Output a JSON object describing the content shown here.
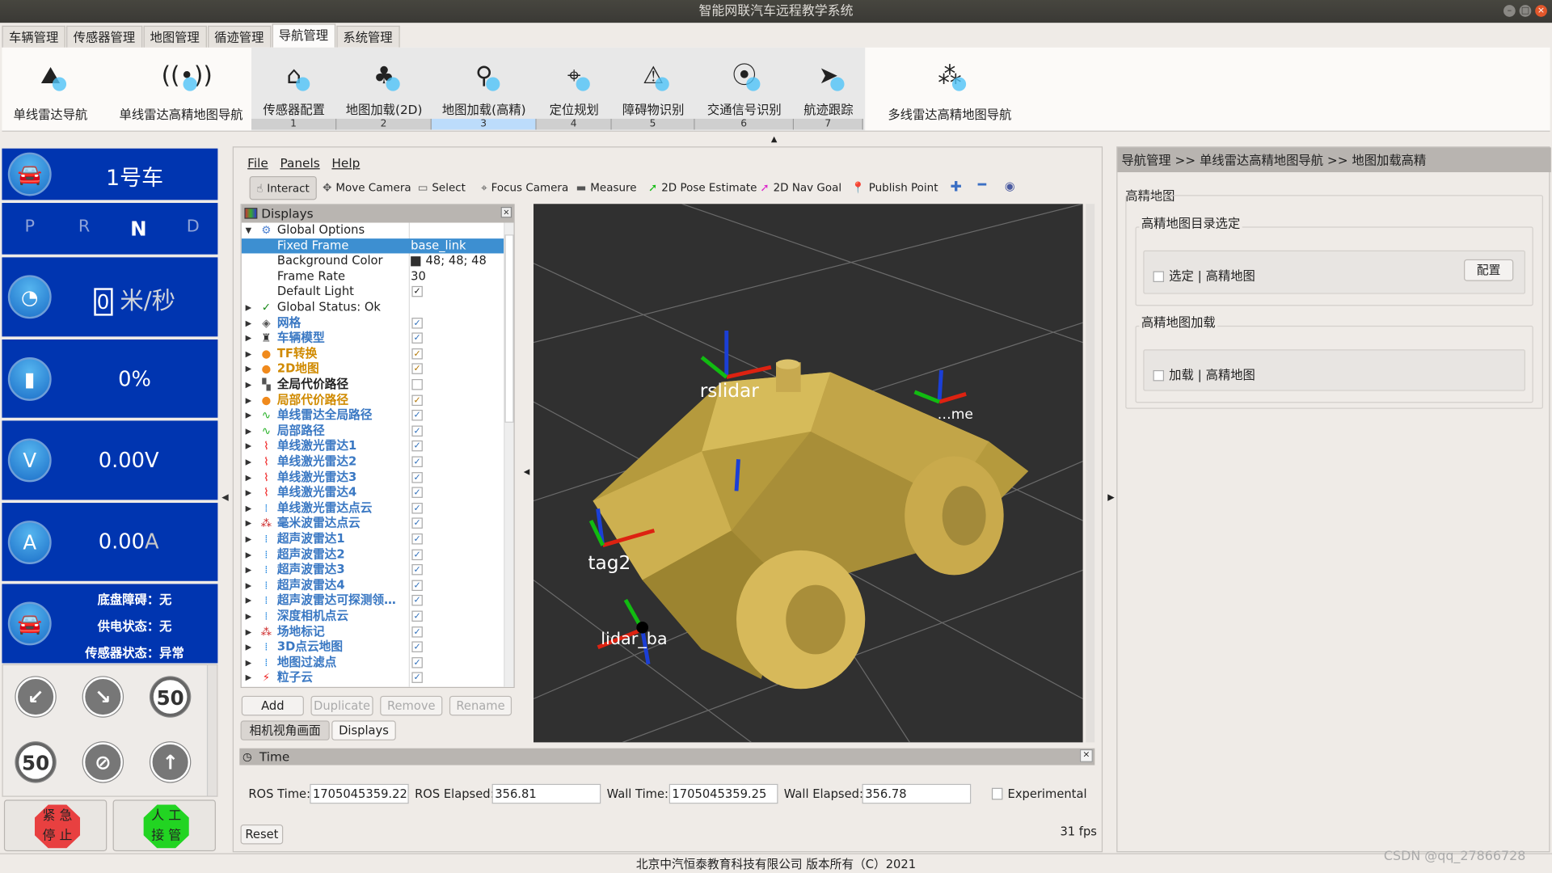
{
  "window": {
    "title": "智能网联汽车远程教学系统"
  },
  "tabs": [
    {
      "label": "车辆管理"
    },
    {
      "label": "传感器管理"
    },
    {
      "label": "地图管理"
    },
    {
      "label": "循迹管理"
    },
    {
      "label": "导航管理",
      "active": true
    },
    {
      "label": "系统管理"
    }
  ],
  "ribbon": {
    "left": [
      {
        "label": "单线雷达导航",
        "icon": "map-arrow-icon"
      },
      {
        "label": "单线雷达高精地图导航",
        "icon": "radio-signal-icon"
      }
    ],
    "steps": [
      {
        "label": "传感器配置",
        "num": "1",
        "icon": "sensor-icon"
      },
      {
        "label": "地图加载(2D)",
        "num": "2",
        "icon": "tree-map-icon"
      },
      {
        "label": "地图加载(高精)",
        "num": "3",
        "icon": "map-pin-icon",
        "selected": true
      },
      {
        "label": "定位规划",
        "num": "4",
        "icon": "location-icon"
      },
      {
        "label": "障碍物识别",
        "num": "5",
        "icon": "obstacle-icon"
      },
      {
        "label": "交通信号识别",
        "num": "6",
        "icon": "traffic-light-icon"
      },
      {
        "label": "航迹跟踪",
        "num": "7",
        "icon": "navigation-icon"
      }
    ],
    "right": {
      "label": "多线雷达高精地图导航",
      "icon": "nodes-icon"
    }
  },
  "left_panel": {
    "vehicle": "1号车",
    "gears": [
      "P",
      "R",
      "N",
      "D"
    ],
    "active_gear": "N",
    "speed_value": "0",
    "speed_unit": "米/秒",
    "battery": "0%",
    "voltage": "0.00V",
    "current_value": "0.00",
    "current_unit": "A",
    "status": [
      {
        "label": "底盘障碍：",
        "value": "无"
      },
      {
        "label": "供电状态：",
        "value": "无"
      },
      {
        "label": "传感器状态：",
        "value": "异常"
      }
    ],
    "signs": [
      "↙",
      "↘",
      "50",
      "50",
      "⊘",
      "↑"
    ],
    "emergency": {
      "line1": "紧 急",
      "line2": "停 止",
      "color": "#e84040"
    },
    "takeover": {
      "line1": "人 工",
      "line2": "接 管",
      "color": "#22d422"
    }
  },
  "rviz": {
    "menu": [
      "File",
      "Panels",
      "Help"
    ],
    "tools": [
      {
        "label": "Interact",
        "icon": "hand-icon"
      },
      {
        "label": "Move Camera",
        "icon": "move-icon"
      },
      {
        "label": "Select",
        "icon": "select-icon"
      },
      {
        "label": "Focus Camera",
        "icon": "focus-icon"
      },
      {
        "label": "Measure",
        "icon": "ruler-icon"
      },
      {
        "label": "2D Pose Estimate",
        "icon": "green-arrow-icon"
      },
      {
        "label": "2D Nav Goal",
        "icon": "pink-arrow-icon"
      },
      {
        "label": "Publish Point",
        "icon": "pin-icon"
      }
    ],
    "displays_title": "Displays",
    "global_options": "Global Options",
    "props": [
      {
        "label": "Fixed Frame",
        "value": "base_link"
      },
      {
        "label": "Background Color",
        "value": "48; 48; 48"
      },
      {
        "label": "Frame Rate",
        "value": "30"
      },
      {
        "label": "Default Light",
        "value": "✓"
      }
    ],
    "global_status": "Global Status: Ok",
    "items": [
      {
        "label": "网格",
        "icon": "grid-icon",
        "color": "#3a78c3",
        "checked": true
      },
      {
        "label": "车辆模型",
        "icon": "robot-icon",
        "color": "#3a78c3",
        "checked": true
      },
      {
        "label": "TF转换",
        "icon": "warning-icon",
        "color": "#d08a00",
        "checked": true
      },
      {
        "label": "2D地图",
        "icon": "warning-icon",
        "color": "#d08a00",
        "checked": true
      },
      {
        "label": "全局代价路径",
        "icon": "map-icon",
        "color": "#222222",
        "checked": false
      },
      {
        "label": "局部代价路径",
        "icon": "warning-icon",
        "color": "#d08a00",
        "checked": true
      },
      {
        "label": "单线雷达全局路径",
        "icon": "path-icon",
        "color": "#3a78c3",
        "checked": true
      },
      {
        "label": "局部路径",
        "icon": "path-icon",
        "color": "#3a78c3",
        "checked": true
      },
      {
        "label": "单线激光雷达1",
        "icon": "laser-icon",
        "color": "#3a78c3",
        "checked": true
      },
      {
        "label": "单线激光雷达2",
        "icon": "laser-icon",
        "color": "#3a78c3",
        "checked": true
      },
      {
        "label": "单线激光雷达3",
        "icon": "laser-icon",
        "color": "#3a78c3",
        "checked": true
      },
      {
        "label": "单线激光雷达4",
        "icon": "laser-icon",
        "color": "#3a78c3",
        "checked": true
      },
      {
        "label": "单线激光雷达点云",
        "icon": "pointcloud-icon",
        "color": "#3a78c3",
        "checked": true
      },
      {
        "label": "毫米波雷达点云",
        "icon": "marker-icon",
        "color": "#3a78c3",
        "checked": true
      },
      {
        "label": "超声波雷达1",
        "icon": "pointcloud-icon",
        "color": "#3a78c3",
        "checked": true
      },
      {
        "label": "超声波雷达2",
        "icon": "pointcloud-icon",
        "color": "#3a78c3",
        "checked": true
      },
      {
        "label": "超声波雷达3",
        "icon": "pointcloud-icon",
        "color": "#3a78c3",
        "checked": true
      },
      {
        "label": "超声波雷达4",
        "icon": "pointcloud-icon",
        "color": "#3a78c3",
        "checked": true
      },
      {
        "label": "超声波雷达可探测领…",
        "icon": "pointcloud-icon",
        "color": "#3a78c3",
        "checked": true
      },
      {
        "label": "深度相机点云",
        "icon": "pointcloud-icon",
        "color": "#3a78c3",
        "checked": true
      },
      {
        "label": "场地标记",
        "icon": "marker-icon",
        "color": "#3a78c3",
        "checked": true
      },
      {
        "label": "3D点云地图",
        "icon": "pointcloud-icon",
        "color": "#3a78c3",
        "checked": true
      },
      {
        "label": "地图过滤点",
        "icon": "pointcloud-icon",
        "color": "#3a78c3",
        "checked": true
      },
      {
        "label": "粒子云",
        "icon": "particle-icon",
        "color": "#3a78c3",
        "checked": true
      }
    ],
    "buttons": {
      "add": "Add",
      "duplicate": "Duplicate",
      "remove": "Remove",
      "rename": "Rename"
    },
    "bottom_tabs": [
      "相机视角画面",
      "Displays"
    ],
    "frames": [
      "rslidar",
      "tag2",
      "lidar_ba",
      "…me"
    ],
    "time": {
      "title": "Time",
      "ros_time_label": "ROS Time:",
      "ros_time": "1705045359.22",
      "ros_elapsed_label": "ROS Elapsed:",
      "ros_elapsed": "356.81",
      "wall_time_label": "Wall Time:",
      "wall_time": "1705045359.25",
      "wall_elapsed_label": "Wall Elapsed:",
      "wall_elapsed": "356.78",
      "experimental": "Experimental",
      "reset": "Reset",
      "fps": "31 fps"
    }
  },
  "right_panel": {
    "breadcrumb": "导航管理 >> 单线雷达高精地图导航 >> 地图加载高精",
    "section": "高精地图",
    "group1": "高精地图目录选定",
    "checkbox1": "选定 | 高精地图",
    "config_button": "配置",
    "group2": "高精地图加载",
    "checkbox2": "加载 | 高精地图"
  },
  "footer": "北京中汽恒泰教育科技有限公司 版本所有（C）2021",
  "watermark": "CSDN @qq_27866728"
}
